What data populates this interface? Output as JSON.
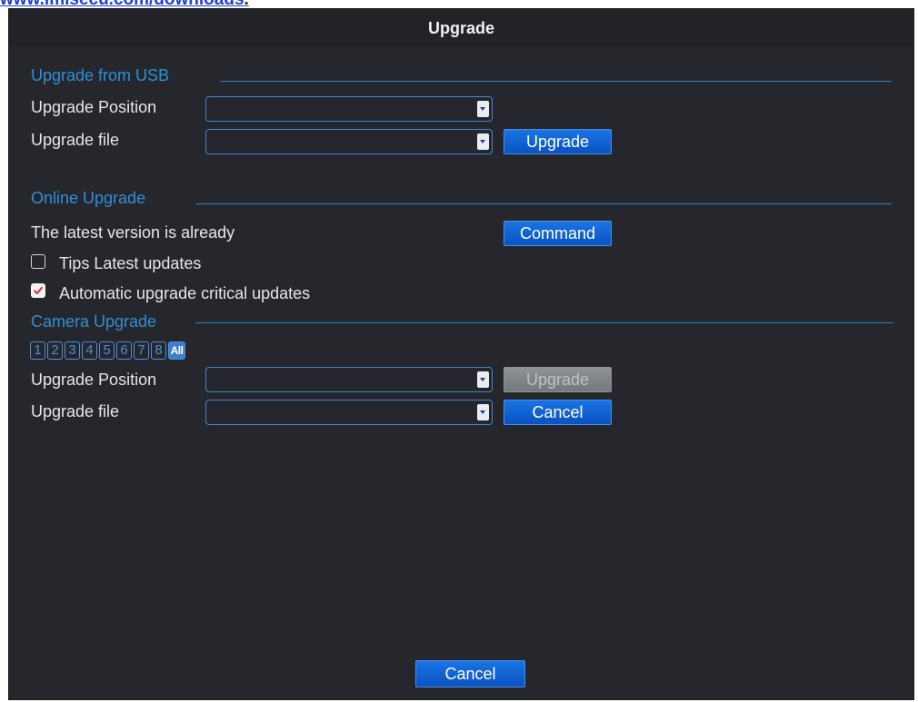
{
  "top_link": {
    "text": "www.lmisecu.com/downloads",
    "dot": "."
  },
  "window": {
    "title": "Upgrade"
  },
  "usb_section": {
    "title": "Upgrade from USB",
    "position_label": "Upgrade Position",
    "position_value": "",
    "file_label": "Upgrade file",
    "file_value": "",
    "upgrade_button": "Upgrade"
  },
  "online_section": {
    "title": "Online Upgrade",
    "status_text": "The latest version is already",
    "command_button": "Command",
    "tips_label": "Tips Latest updates",
    "tips_checked": false,
    "auto_label": "Automatic upgrade critical updates",
    "auto_checked": true
  },
  "camera_section": {
    "title": "Camera Upgrade",
    "channels": [
      "1",
      "2",
      "3",
      "4",
      "5",
      "6",
      "7",
      "8",
      "All"
    ],
    "position_label": "Upgrade Position",
    "position_value": "",
    "file_label": "Upgrade file",
    "file_value": "",
    "upgrade_button": "Upgrade",
    "cancel_button": "Cancel"
  },
  "footer": {
    "cancel_button": "Cancel"
  },
  "colors": {
    "accent": "#2f8fd6",
    "button": "#0a52c1",
    "background": "#25272d"
  }
}
